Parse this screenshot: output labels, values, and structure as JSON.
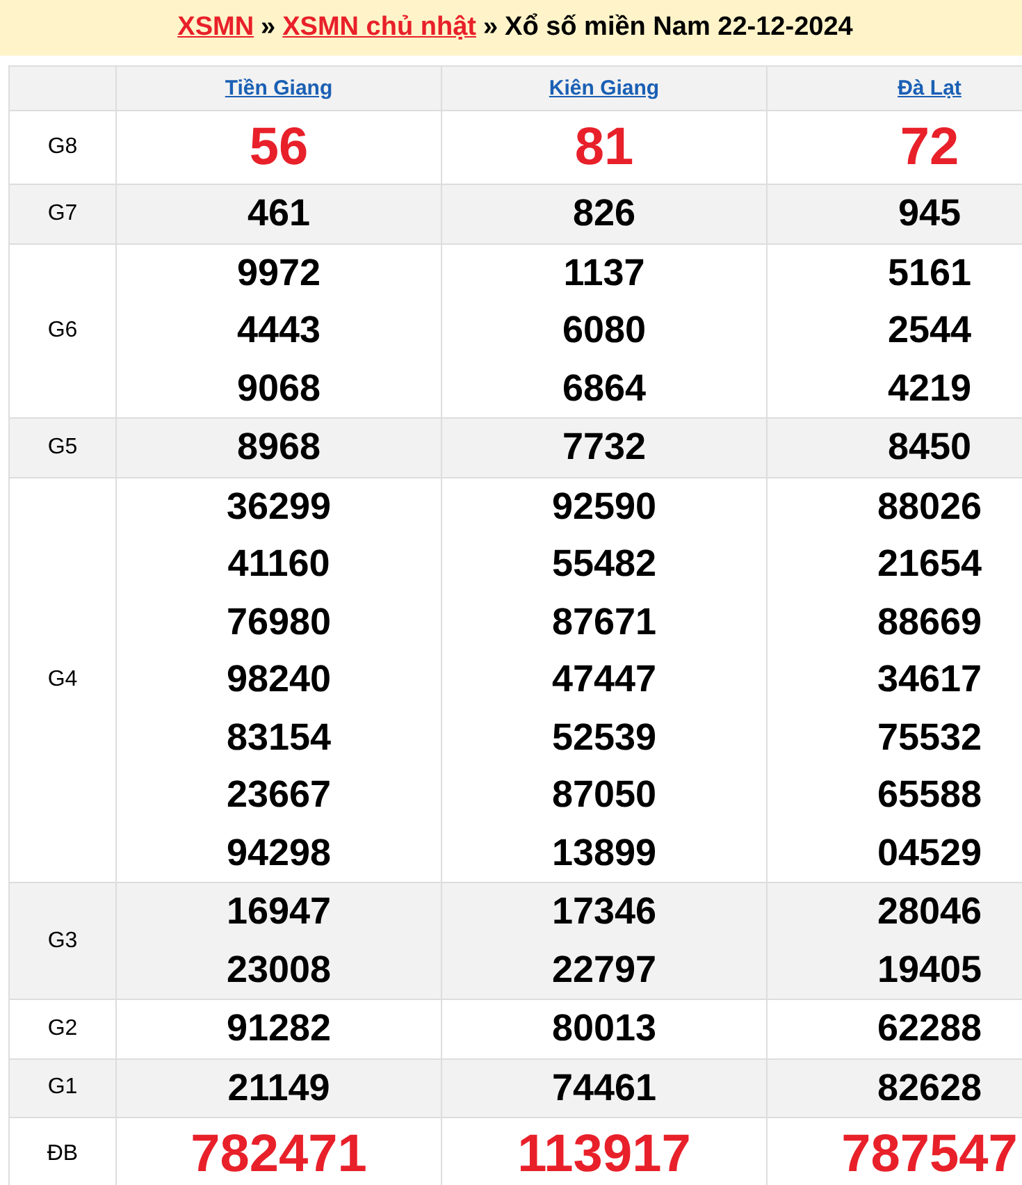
{
  "breadcrumb": [
    {
      "kind": "link",
      "text": "XSMN"
    },
    {
      "kind": "separator",
      "text": "»"
    },
    {
      "kind": "link",
      "text": "XSMN chủ nhật"
    },
    {
      "kind": "separator",
      "text": "»"
    },
    {
      "kind": "title",
      "text": "Xổ số miền Nam 22-12-2024"
    }
  ],
  "table": {
    "columns": [
      "Tiền Giang",
      "Kiên Giang",
      "Đà Lạt"
    ],
    "rows": [
      {
        "prize": "G8",
        "kind": "highlight",
        "cells": [
          [
            "56"
          ],
          [
            "81"
          ],
          [
            "72"
          ]
        ]
      },
      {
        "prize": "G7",
        "kind": "normal",
        "cells": [
          [
            "461"
          ],
          [
            "826"
          ],
          [
            "945"
          ]
        ]
      },
      {
        "prize": "G6",
        "kind": "normal",
        "cells": [
          [
            "9972",
            "4443",
            "9068"
          ],
          [
            "1137",
            "6080",
            "6864"
          ],
          [
            "5161",
            "2544",
            "4219"
          ]
        ]
      },
      {
        "prize": "G5",
        "kind": "normal",
        "cells": [
          [
            "8968"
          ],
          [
            "7732"
          ],
          [
            "8450"
          ]
        ]
      },
      {
        "prize": "G4",
        "kind": "normal",
        "cells": [
          [
            "36299",
            "41160",
            "76980",
            "98240",
            "83154",
            "23667",
            "94298"
          ],
          [
            "92590",
            "55482",
            "87671",
            "47447",
            "52539",
            "87050",
            "13899"
          ],
          [
            "88026",
            "21654",
            "88669",
            "34617",
            "75532",
            "65588",
            "04529"
          ]
        ]
      },
      {
        "prize": "G3",
        "kind": "normal",
        "cells": [
          [
            "16947",
            "23008"
          ],
          [
            "17346",
            "22797"
          ],
          [
            "28046",
            "19405"
          ]
        ]
      },
      {
        "prize": "G2",
        "kind": "normal",
        "cells": [
          [
            "91282"
          ],
          [
            "80013"
          ],
          [
            "62288"
          ]
        ]
      },
      {
        "prize": "G1",
        "kind": "normal",
        "cells": [
          [
            "21149"
          ],
          [
            "74461"
          ],
          [
            "82628"
          ]
        ]
      },
      {
        "prize": "ĐB",
        "kind": "highlight",
        "cells": [
          [
            "782471"
          ],
          [
            "113917"
          ],
          [
            "787547"
          ]
        ]
      }
    ]
  }
}
